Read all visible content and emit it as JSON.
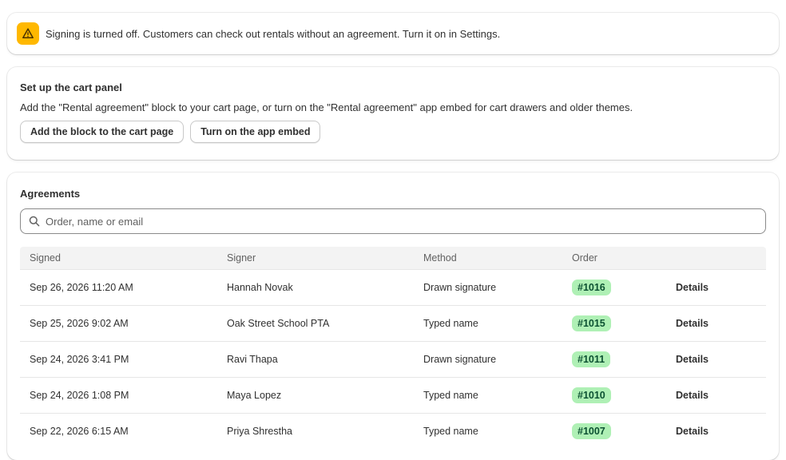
{
  "banner": {
    "icon": "warning-triangle-icon",
    "accent_color": "#ffb800",
    "text": "Signing is turned off. Customers can check out rentals without an agreement. Turn it on in Settings."
  },
  "setup": {
    "title": "Set up the cart panel",
    "description": "Add the \"Rental agreement\" block to your cart page, or turn on the \"Rental agreement\" app embed for cart drawers and older themes.",
    "add_block_label": "Add the block to the cart page",
    "app_embed_label": "Turn on the app embed"
  },
  "agreements": {
    "title": "Agreements",
    "search_placeholder": "Order, name or email",
    "search_value": "",
    "columns": [
      "Signed",
      "Signer",
      "Method",
      "Order",
      ""
    ],
    "rows": [
      {
        "signed": "Sep 26, 2026 11:20 AM",
        "signer": "Hannah Novak",
        "method": "Drawn signature",
        "order": "#1016",
        "action": "Details"
      },
      {
        "signed": "Sep 25, 2026 9:02 AM",
        "signer": "Oak Street School PTA",
        "method": "Typed name",
        "order": "#1015",
        "action": "Details"
      },
      {
        "signed": "Sep 24, 2026 3:41 PM",
        "signer": "Ravi Thapa",
        "method": "Drawn signature",
        "order": "#1011",
        "action": "Details"
      },
      {
        "signed": "Sep 24, 2026 1:08 PM",
        "signer": "Maya Lopez",
        "method": "Typed name",
        "order": "#1010",
        "action": "Details"
      },
      {
        "signed": "Sep 22, 2026 6:15 AM",
        "signer": "Priya Shrestha",
        "method": "Typed name",
        "order": "#1007",
        "action": "Details"
      }
    ],
    "badge_bg_color": "#aff0b5",
    "badge_text_color": "#0c5132"
  }
}
